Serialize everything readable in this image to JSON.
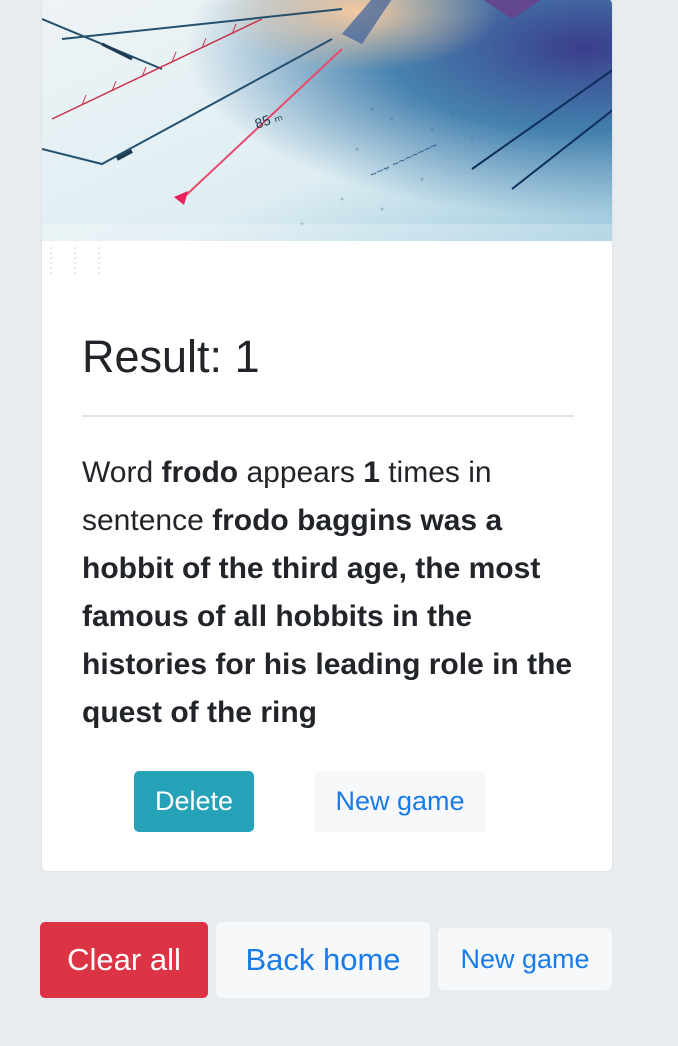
{
  "card": {
    "image_alt": "sketch with measurements",
    "title_prefix": "Result: ",
    "result_value": "1",
    "text": {
      "word_label": "Word ",
      "word": "frodo",
      "appears_label": " appears ",
      "count": "1",
      "times_label": " times in sentence ",
      "sentence": "frodo baggins was a hobbit of the third age, the most famous of all hobbits in the histories for his leading role in the quest of the ring"
    },
    "delete_label": "Delete",
    "new_game_label": "New game"
  },
  "footer": {
    "clear_all_label": "Clear all",
    "back_home_label": "Back home",
    "new_game_label": "New game"
  },
  "colors": {
    "info": "#25a2b8",
    "danger": "#dc3444",
    "light": "#f7f8f9",
    "link": "#1a7be8",
    "page_bg": "#e9ecef"
  }
}
